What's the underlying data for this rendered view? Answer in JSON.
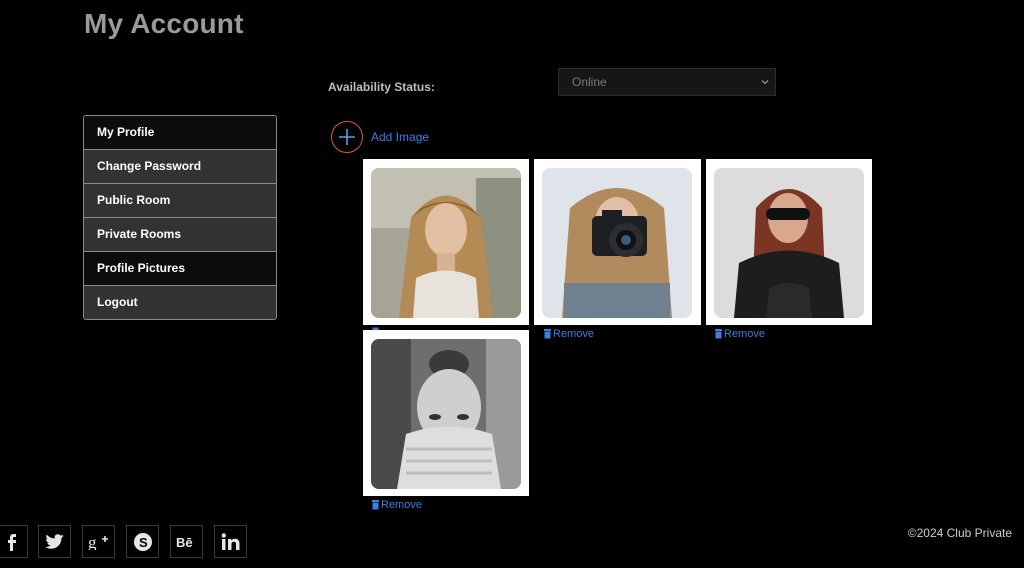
{
  "page": {
    "title": "My Account"
  },
  "availability": {
    "label": "Availability Status:",
    "selected": "Online"
  },
  "sidebar": {
    "items": [
      {
        "label": "My Profile"
      },
      {
        "label": "Change Password"
      },
      {
        "label": "Public Room"
      },
      {
        "label": "Private Rooms"
      },
      {
        "label": "Profile Pictures"
      },
      {
        "label": "Logout"
      }
    ]
  },
  "gallery": {
    "add_label": "Add Image",
    "remove_label": "Remove"
  },
  "footer": {
    "social": [
      "facebook-icon",
      "twitter-icon",
      "google-plus-icon",
      "skype-icon",
      "behance-icon",
      "linkedin-icon"
    ],
    "copyright": "©2024 Club Private"
  },
  "colors": {
    "link": "#3d7ee0",
    "accent_ring": "#e0553a"
  }
}
